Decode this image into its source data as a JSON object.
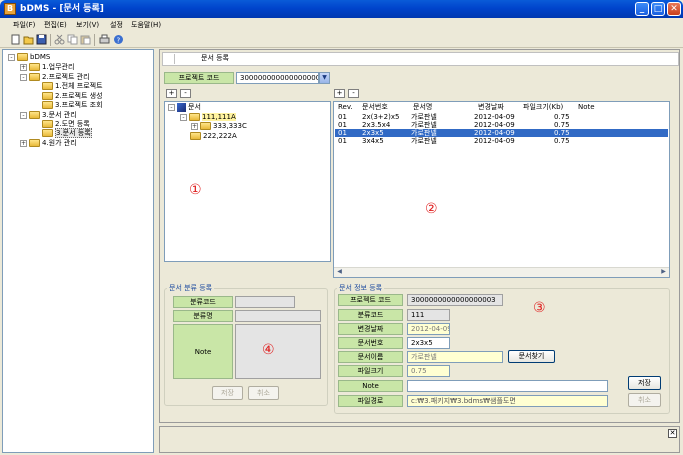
{
  "window": {
    "title": "bDMS - [문서 등록]",
    "app_icon_letter": "B",
    "minimize": "_",
    "maximize": "□",
    "close": "✕"
  },
  "menu": [
    "파일(F)",
    "편집(E)",
    "보기(V)",
    "설정",
    "도움말(H)"
  ],
  "toolbar_icons": [
    "new-icon",
    "open-icon",
    "save-icon",
    "cut-icon",
    "copy-icon",
    "paste-icon",
    "print-icon",
    "help-icon"
  ],
  "nav_tree": {
    "root": "bDMS",
    "items": [
      {
        "label": "1.업무관리",
        "level": 1
      },
      {
        "label": "2.프로젝트 관리",
        "level": 1
      },
      {
        "label": "1.전체 프로젝트",
        "level": 2
      },
      {
        "label": "2.프로젝트 생성",
        "level": 2
      },
      {
        "label": "3.프로젝트 조회",
        "level": 2
      },
      {
        "label": "3.문서 관리",
        "level": 1
      },
      {
        "label": "2.도면 등록",
        "level": 2
      },
      {
        "label": "3.문서 등록",
        "level": 2
      },
      {
        "label": "4.원가 관리",
        "level": 1
      }
    ]
  },
  "page": {
    "header": "문서 등록"
  },
  "project": {
    "label": "프로젝트 코드",
    "value": "3000000000000000003"
  },
  "folder_tree": {
    "plus": "+",
    "minus": "-",
    "root": "문서",
    "items": [
      "111,111A",
      "333,333C",
      "222,222A"
    ]
  },
  "doc_grid": {
    "plus": "+",
    "minus": "-",
    "headers": [
      "Rev.",
      "문서번호",
      "문서명",
      "변경날짜",
      "파일크기(Kb)",
      "Note"
    ],
    "rows": [
      [
        "01",
        "2x(3+2)x5",
        "가로판넬",
        "2012-04-09",
        "0.75",
        ""
      ],
      [
        "01",
        "2x3.5x4",
        "가로판넬",
        "2012-04-09",
        "0.75",
        ""
      ],
      [
        "01",
        "2x3x5",
        "가로판넬",
        "2012-04-09",
        "0.75",
        ""
      ],
      [
        "01",
        "3x4x5",
        "가로판넬",
        "2012-04-09",
        "0.75",
        ""
      ]
    ],
    "selected_row": 2
  },
  "category_form": {
    "title": "문서 분류 등록",
    "code_label": "분류코드",
    "name_label": "분류명",
    "note_label": "Note",
    "save": "저장",
    "cancel": "취소"
  },
  "info_form": {
    "title": "문서 정보 등록",
    "project_code_label": "프로젝트 코드",
    "project_code": "3000000000000000003",
    "category_code_label": "분류코드",
    "category_code": "111",
    "date_label": "변경날짜",
    "date": "2012-04-09",
    "doc_no_label": "문서번호",
    "doc_no": "2x3x5",
    "doc_name_label": "문서이름",
    "doc_name": "가로판넬",
    "find_button": "문서찾기",
    "size_label": "파일크기",
    "size": "0.75",
    "note_label": "Note",
    "note": "",
    "path_label": "파일경로",
    "path": "c:₩3.패키지₩3.bdms₩샘플도면",
    "save": "저장",
    "cancel": "취소"
  },
  "annotations": [
    "①",
    "②",
    "③",
    "④"
  ],
  "status_close": "✕"
}
